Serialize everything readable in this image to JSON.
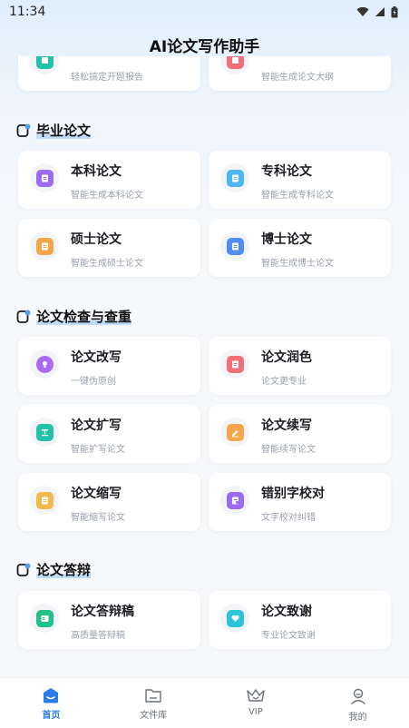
{
  "status": {
    "time": "11:34"
  },
  "header": {
    "title": "AI论文写作助手"
  },
  "top_cards": [
    {
      "sub": "轻松搞定开题报告",
      "color": "#21c2a8"
    },
    {
      "sub": "智能生成论文大纲",
      "color": "#f26f7a"
    }
  ],
  "sections": {
    "graduation": {
      "title": "毕业论文"
    },
    "check": {
      "title": "论文检查与查重"
    },
    "defense": {
      "title": "论文答辩"
    }
  },
  "cards": {
    "bachelor": {
      "title": "本科论文",
      "sub": "智能生成本科论文",
      "color": "#9b6cf0"
    },
    "junior": {
      "title": "专科论文",
      "sub": "智能生成专科论文",
      "color": "#4bb8f0"
    },
    "master": {
      "title": "硕士论文",
      "sub": "智能生成硕士论文",
      "color": "#f5a64a"
    },
    "doctor": {
      "title": "博士论文",
      "sub": "智能生成博士论文",
      "color": "#4f8ef0"
    },
    "rewrite": {
      "title": "论文改写",
      "sub": "一键伪原创",
      "color": "#a86cf0"
    },
    "polish": {
      "title": "论文润色",
      "sub": "论文更专业",
      "color": "#f26f7a"
    },
    "expand": {
      "title": "论文扩写",
      "sub": "智能扩写论文",
      "color": "#21c2a8"
    },
    "continue": {
      "title": "论文续写",
      "sub": "智能续写论文",
      "color": "#f5a64a"
    },
    "shorten": {
      "title": "论文缩写",
      "sub": "智能缩写论文",
      "color": "#f5b84a"
    },
    "proofread": {
      "title": "错别字校对",
      "sub": "文字校对纠错",
      "color": "#9b6cf0"
    },
    "defense_script": {
      "title": "论文答辩稿",
      "sub": "高质量答辩稿",
      "color": "#21c28a"
    },
    "thanks": {
      "title": "论文致谢",
      "sub": "专业论文致谢",
      "color": "#2bc3d6"
    }
  },
  "tabs": {
    "home": "首页",
    "library": "文件库",
    "vip": "VIP",
    "mine": "我的"
  },
  "colors": {
    "accent": "#2b7de9"
  }
}
